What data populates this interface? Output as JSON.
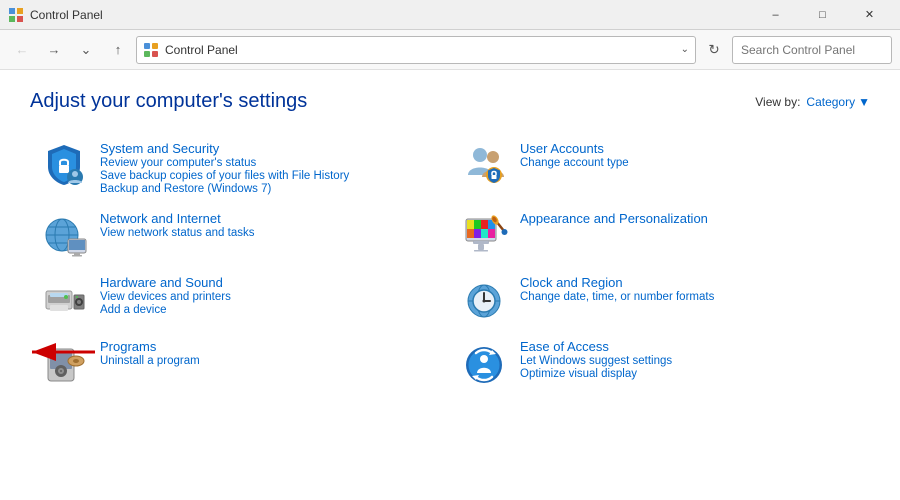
{
  "titleBar": {
    "icon": "control-panel",
    "text": "Control Panel",
    "minimizeLabel": "–",
    "maximizeLabel": "□",
    "closeLabel": "✕"
  },
  "addressBar": {
    "addressLabel": "Control Panel",
    "chevron": "∨",
    "searchPlaceholder": "Search Control Panel"
  },
  "page": {
    "title": "Adjust your computer's settings",
    "viewByLabel": "View by:",
    "viewByValue": "Category"
  },
  "categories": [
    {
      "id": "system-security",
      "title": "System and Security",
      "links": [
        "Review your computer's status",
        "Save backup copies of your files with File History",
        "Backup and Restore (Windows 7)"
      ]
    },
    {
      "id": "user-accounts",
      "title": "User Accounts",
      "links": [
        "Change account type"
      ]
    },
    {
      "id": "network-internet",
      "title": "Network and Internet",
      "links": [
        "View network status and tasks"
      ]
    },
    {
      "id": "appearance",
      "title": "Appearance and Personalization",
      "links": []
    },
    {
      "id": "hardware-sound",
      "title": "Hardware and Sound",
      "links": [
        "View devices and printers",
        "Add a device"
      ]
    },
    {
      "id": "clock-region",
      "title": "Clock and Region",
      "links": [
        "Change date, time, or number formats"
      ]
    },
    {
      "id": "programs",
      "title": "Programs",
      "links": [
        "Uninstall a program"
      ]
    },
    {
      "id": "ease-of-access",
      "title": "Ease of Access",
      "links": [
        "Let Windows suggest settings",
        "Optimize visual display"
      ]
    }
  ]
}
